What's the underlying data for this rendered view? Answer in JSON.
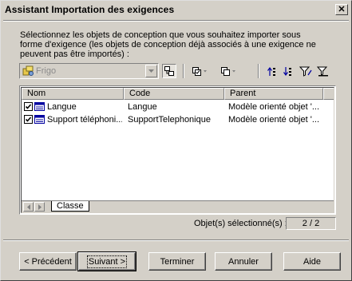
{
  "window": {
    "title": "Assistant Importation des exigences",
    "close_glyph": "✕"
  },
  "instructions": "Sélectionnez les objets de conception que vous souhaitez importer sous forme d'exigence (les objets de conception déjà associés à une exigence ne peuvent pas être importés) :",
  "model_combo": {
    "value": "Frigo",
    "icon": "model-icon"
  },
  "toolbar": {
    "icons": [
      "select-all-icon",
      "include-sub-packages-icon",
      "select-icon",
      "deselect-icon",
      "move-up-icon",
      "move-down-icon",
      "filter-icon",
      "clear-filter-icon"
    ]
  },
  "table": {
    "columns": [
      "Nom",
      "Code",
      "Parent"
    ],
    "rows": [
      {
        "checked": true,
        "name": "Langue",
        "code": "Langue",
        "parent": "Modèle orienté objet '..."
      },
      {
        "checked": true,
        "name": "Support téléphoni...",
        "code": "SupportTelephonique",
        "parent": "Modèle orienté objet '..."
      }
    ]
  },
  "tabs": [
    "Classe"
  ],
  "selection": {
    "label": "Objet(s) sélectionné(s) :",
    "value": "2 / 2"
  },
  "buttons": {
    "previous": "< Précédent",
    "next": "Suivant >",
    "finish": "Terminer",
    "cancel": "Annuler",
    "help": "Aide"
  },
  "colors": {
    "face": "#d4d0c8",
    "accent_blue": "#0000a0",
    "disabled_text": "#8c8c8c"
  }
}
